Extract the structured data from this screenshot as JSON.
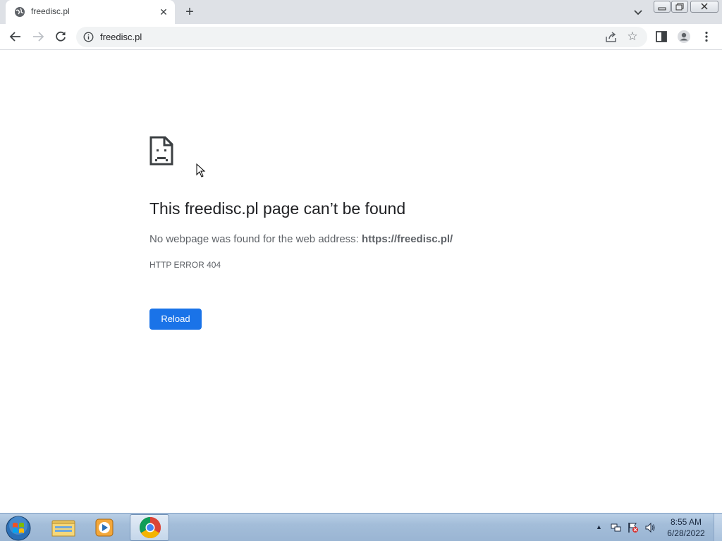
{
  "browser": {
    "tab": {
      "title": "freedisc.pl",
      "favicon": "globe-icon",
      "close_glyph": "✕"
    },
    "new_tab_glyph": "+",
    "address": {
      "url": "freedisc.pl"
    }
  },
  "error": {
    "icon": "sad-page-icon",
    "title": "This freedisc.pl page can’t be found",
    "desc_prefix": "No webpage was found for the web address:",
    "desc_url": "https://freedisc.pl/",
    "code": "HTTP ERROR 404",
    "reload_label": "Reload"
  },
  "taskbar": {
    "apps": [
      "start-orb",
      "file-explorer",
      "media-player",
      "chrome"
    ],
    "clock_time": "8:55 AM",
    "clock_date": "6/28/2022"
  },
  "colors": {
    "accent": "#1a73e8",
    "tabstrip": "#dee1e6",
    "text_primary": "#202124",
    "text_secondary": "#5f6368"
  }
}
